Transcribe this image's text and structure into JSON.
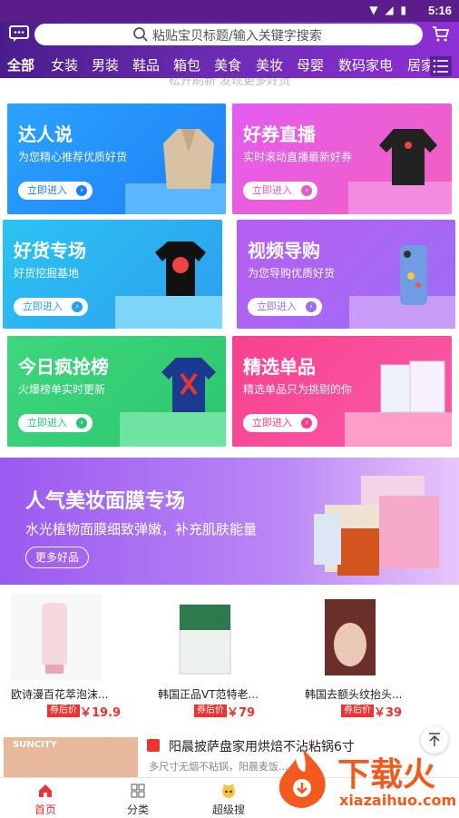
{
  "statusbar": {
    "time": "5:16",
    "icons": "▼ ◢ ▮"
  },
  "header": {
    "search_placeholder": "粘贴宝贝标题/输入关键字搜索",
    "categories": [
      "全部",
      "女装",
      "男装",
      "鞋品",
      "箱包",
      "美食",
      "美妆",
      "母婴",
      "数码家电",
      "居家"
    ]
  },
  "hint": "松开刷新 发现更多好货",
  "cards": [
    {
      "title": "达人说",
      "subtitle": "为您精心推荐优质好货",
      "button": "立即进入"
    },
    {
      "title": "好券直播",
      "subtitle": "实时滚动直播最新好券",
      "button": "立即进入"
    },
    {
      "title": "好货专场",
      "subtitle": "好货挖掘基地",
      "button": "立即进入"
    },
    {
      "title": "视频导购",
      "subtitle": "为您导购优质好货",
      "button": "立即进入"
    },
    {
      "title": "今日疯抢榜",
      "subtitle": "火爆榜单实时更新",
      "button": "立即进入"
    },
    {
      "title": "精选单品",
      "subtitle": "精选单品只为挑剔的你",
      "button": "立即进入"
    }
  ],
  "banner": {
    "title": "人气美妆面膜专场",
    "subtitle": "水光植物面膜细致弹嫩，补充肌肤能量",
    "button": "更多好品"
  },
  "products": [
    {
      "name": "欧诗漫百花萃泡沫...",
      "tag": "券后价",
      "price": "￥19.9"
    },
    {
      "name": "韩国正品VT范特老...",
      "tag": "券后价",
      "price": "￥79"
    },
    {
      "name": "韩国去额头纹抬头...",
      "tag": "券后价",
      "price": "￥39"
    }
  ],
  "feed": {
    "title": "阳晨披萨盘家用烘焙不沾粘锅6寸",
    "subtitle": "多尺寸无烟不粘锅，阳晨麦饭...",
    "thumb_text": "SUNCITY"
  },
  "tabs": [
    "首页",
    "分类",
    "超级搜",
    "",
    ""
  ],
  "watermark": {
    "text": "下载火",
    "url": "xiazaihuo.com"
  }
}
